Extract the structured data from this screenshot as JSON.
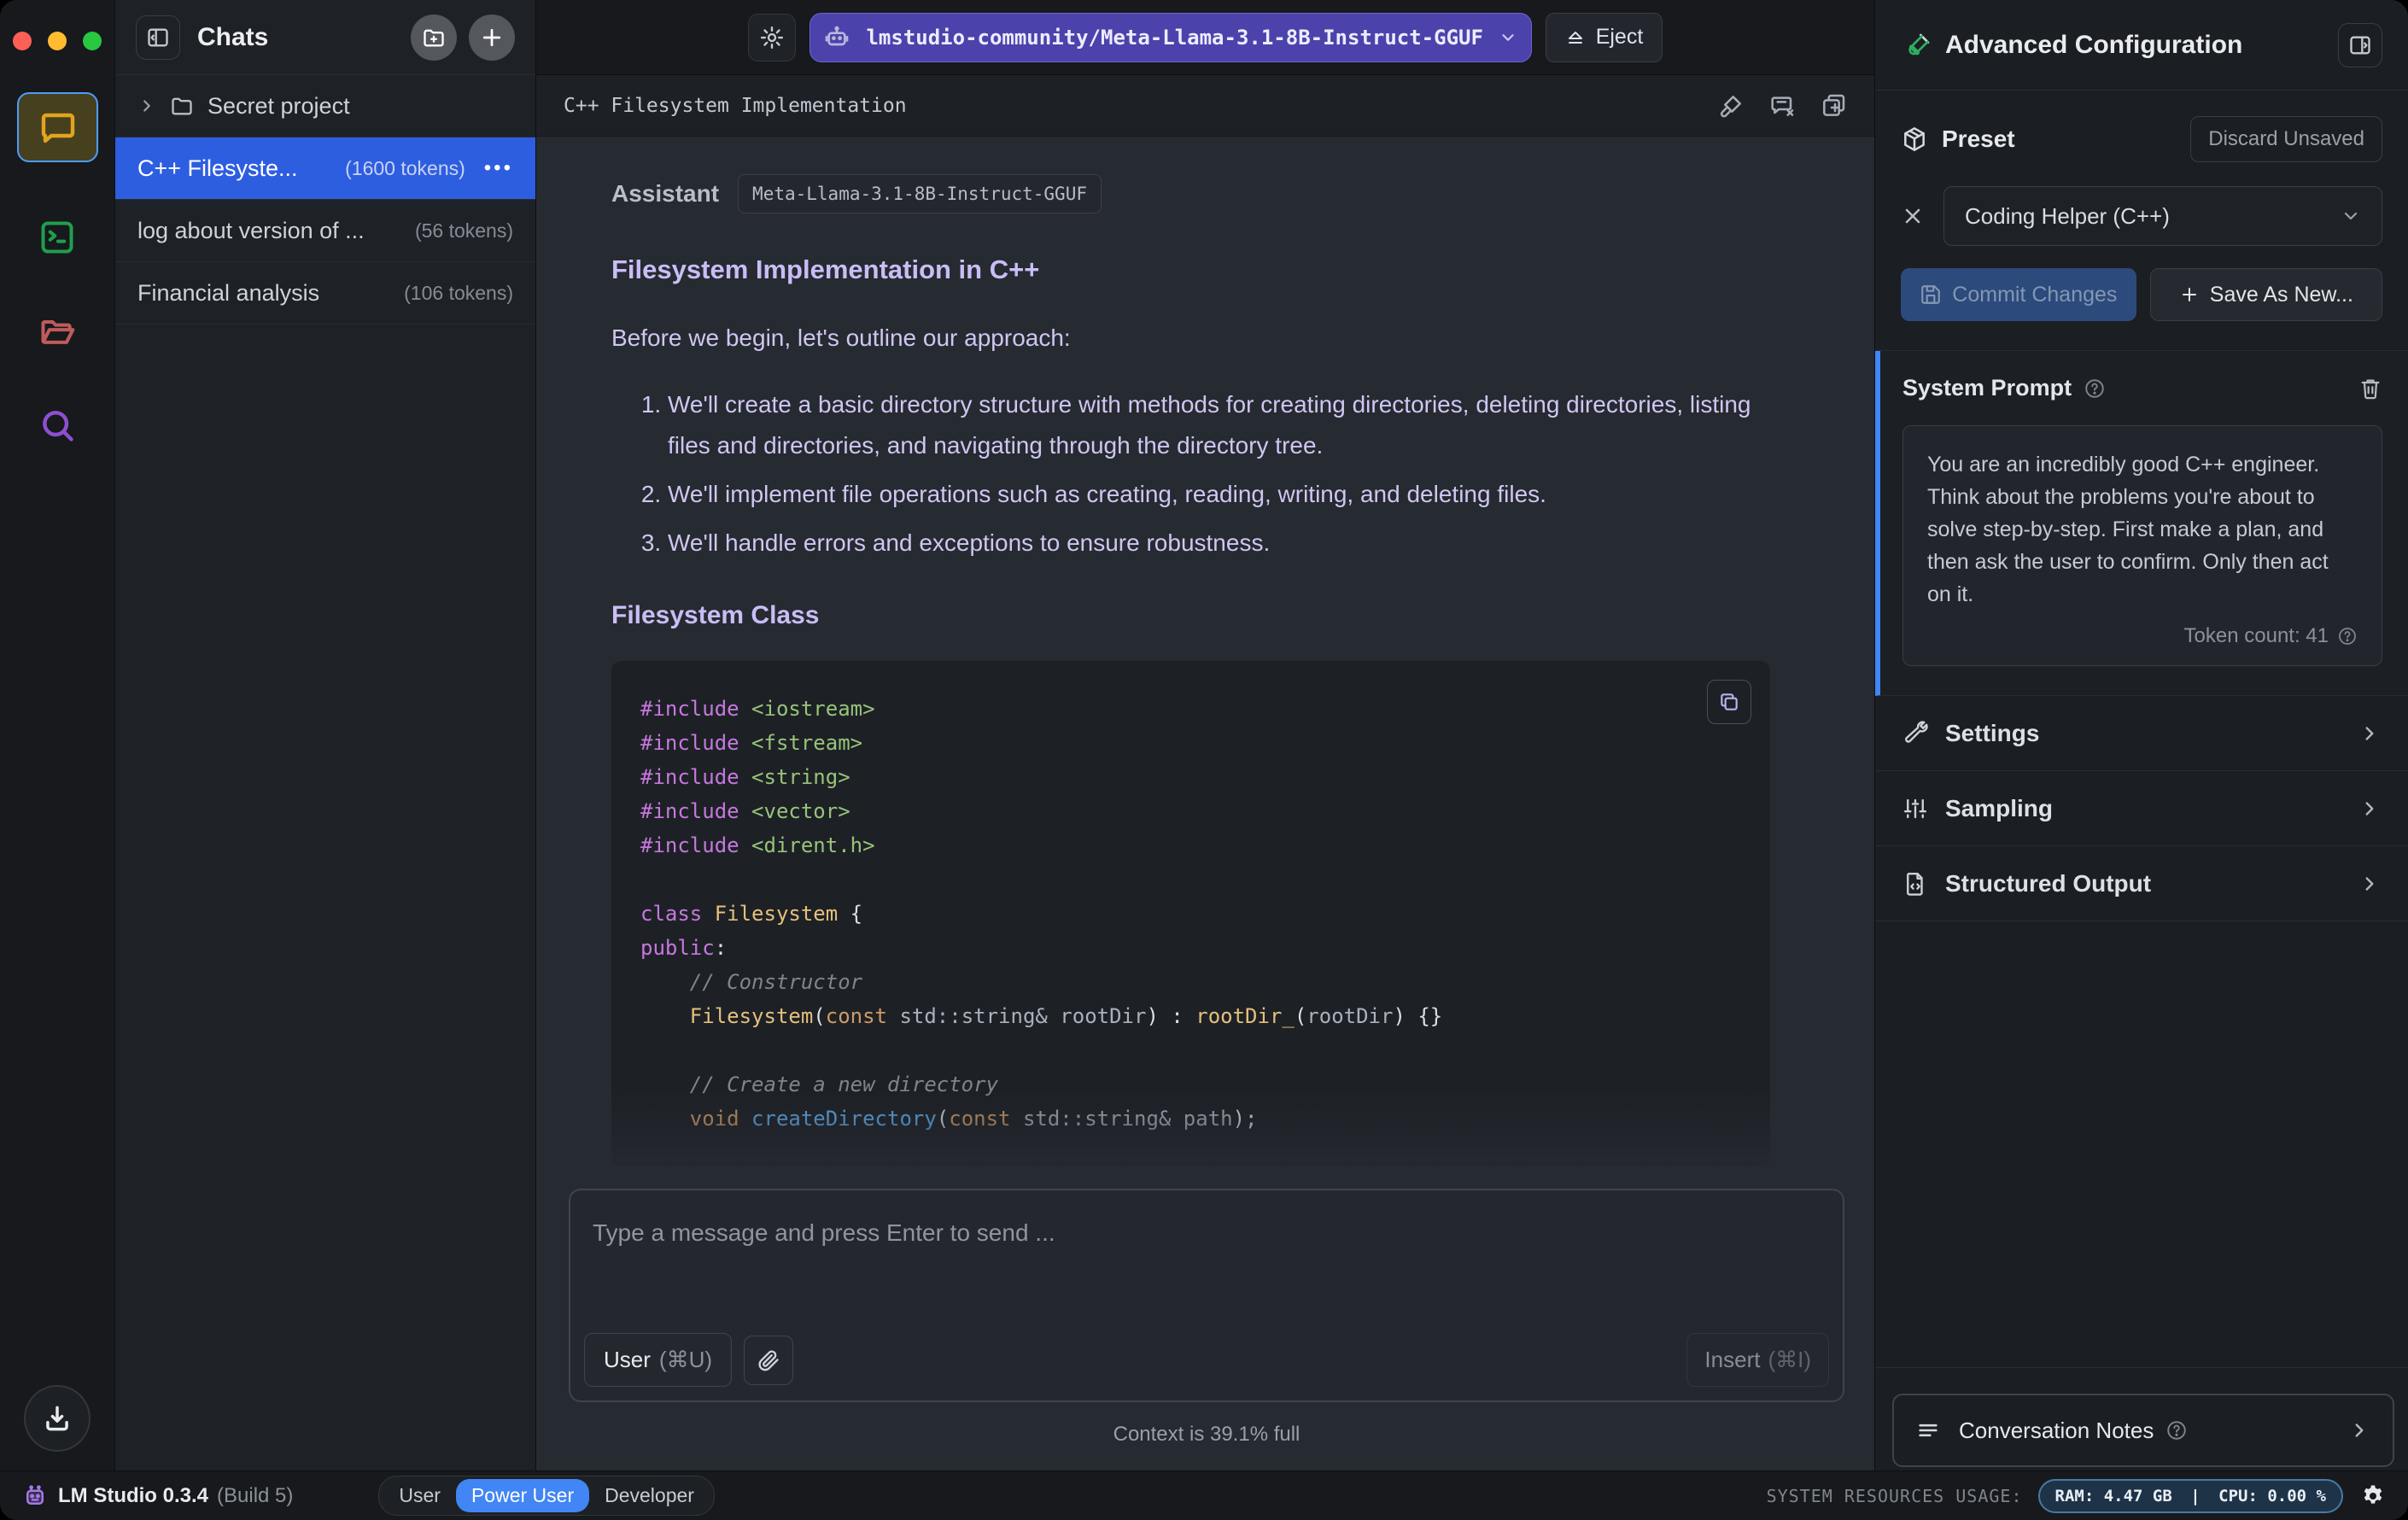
{
  "colors": {
    "selected_chat_blue": "#2e5ee0",
    "model_pill_indigo": "#4b43ab",
    "power_user_blue": "#4285f4",
    "system_prompt_accent": "#4285f4",
    "commit_button_blue": "#2c4a7c",
    "resources_pill_border": "#4879a6",
    "rail_chat_gold": "#e2a41f",
    "rail_terminal_green": "#1f9e4d",
    "rail_folder_red": "#c05b5b",
    "rail_search_purple": "#8f4fd1"
  },
  "chats": {
    "title": "Chats",
    "folder": {
      "name": "Secret project"
    },
    "items": [
      {
        "title": "C++ Filesyste...",
        "tokens": "(1600 tokens)",
        "menu": "•••"
      },
      {
        "title": "log about version of ...",
        "tokens": "(56 tokens)"
      },
      {
        "title": "Financial analysis",
        "tokens": "(106 tokens)"
      }
    ]
  },
  "topbar": {
    "model": "lmstudio-community/Meta-Llama-3.1-8B-Instruct-GGUF",
    "eject": "Eject"
  },
  "chat": {
    "title": "C++ Filesystem Implementation",
    "assistant_label": "Assistant",
    "model_badge": "Meta-Llama-3.1-8B-Instruct-GGUF",
    "heading1": "Filesystem Implementation in C++",
    "intro": "Before we begin, let's outline our approach:",
    "list": [
      "We'll create a basic directory structure with methods for creating directories, deleting directories, listing files and directories, and navigating through the directory tree.",
      "We'll implement file operations such as creating, reading, writing, and deleting files.",
      "We'll handle errors and exceptions to ensure robustness."
    ],
    "heading2": "Filesystem Class"
  },
  "code": {
    "lines": [
      [
        [
          "kw",
          "#include"
        ],
        [
          "pl",
          " "
        ],
        [
          "hdr",
          "<iostream>"
        ]
      ],
      [
        [
          "kw",
          "#include"
        ],
        [
          "pl",
          " "
        ],
        [
          "hdr",
          "<fstream>"
        ]
      ],
      [
        [
          "kw",
          "#include"
        ],
        [
          "pl",
          " "
        ],
        [
          "hdr",
          "<string>"
        ]
      ],
      [
        [
          "kw",
          "#include"
        ],
        [
          "pl",
          " "
        ],
        [
          "hdr",
          "<vector>"
        ]
      ],
      [
        [
          "kw",
          "#include"
        ],
        [
          "pl",
          " "
        ],
        [
          "hdr",
          "<dirent.h>"
        ]
      ],
      [],
      [
        [
          "kw",
          "class"
        ],
        [
          "pl",
          " "
        ],
        [
          "fn2",
          "Filesystem"
        ],
        [
          "wh",
          " {"
        ]
      ],
      [
        [
          "kw",
          "public"
        ],
        [
          "wh",
          ":"
        ]
      ],
      [
        [
          "pl",
          "    "
        ],
        [
          "cmt",
          "// Constructor"
        ]
      ],
      [
        [
          "pl",
          "    "
        ],
        [
          "fn2",
          "Filesystem"
        ],
        [
          "wh",
          "("
        ],
        [
          "kw2",
          "const"
        ],
        [
          "pl",
          " std::string& rootDir"
        ],
        [
          "wh",
          ") "
        ],
        [
          "wh",
          ": "
        ],
        [
          "fn2",
          "rootDir_"
        ],
        [
          "wh",
          "("
        ],
        [
          "pl",
          "rootDir"
        ],
        [
          "wh",
          ") {}"
        ]
      ],
      [],
      [
        [
          "pl",
          "    "
        ],
        [
          "cmt",
          "// Create a new directory"
        ]
      ],
      [
        [
          "pl",
          "    "
        ],
        [
          "kw2",
          "void"
        ],
        [
          "pl",
          " "
        ],
        [
          "fn",
          "createDirectory"
        ],
        [
          "wh",
          "("
        ],
        [
          "kw2",
          "const"
        ],
        [
          "pl",
          " std::string& path"
        ],
        [
          "wh",
          ");"
        ]
      ]
    ]
  },
  "composer": {
    "placeholder": "Type a message and press Enter to send ...",
    "role": "User",
    "role_shortcut": "(⌘U)",
    "insert": "Insert",
    "insert_shortcut": "(⌘I)",
    "context": "Context is 39.1% full"
  },
  "panel": {
    "title": "Advanced Configuration",
    "preset": {
      "label": "Preset",
      "discard": "Discard Unsaved",
      "selected": "Coding Helper (C++)",
      "commit": "Commit Changes",
      "save_new": "Save As New..."
    },
    "system_prompt": {
      "label": "System Prompt",
      "text": "You are an incredibly good C++ engineer.\nThink about the problems you're about to\nsolve step-by-step. First make a plan, and\nthen ask the user to confirm. Only then act\non it.",
      "token_count": "Token count: 41"
    },
    "sections": [
      {
        "label": "Settings"
      },
      {
        "label": "Sampling"
      },
      {
        "label": "Structured Output"
      }
    ],
    "notes": {
      "label": "Conversation Notes"
    }
  },
  "statusbar": {
    "app": "LM Studio 0.3.4",
    "build": "(Build 5)",
    "modes": [
      "User",
      "Power User",
      "Developer"
    ],
    "resources_label": "SYSTEM RESOURCES USAGE:",
    "ram": "RAM: 4.47 GB",
    "sep": "|",
    "cpu": "CPU: 0.00 %"
  }
}
